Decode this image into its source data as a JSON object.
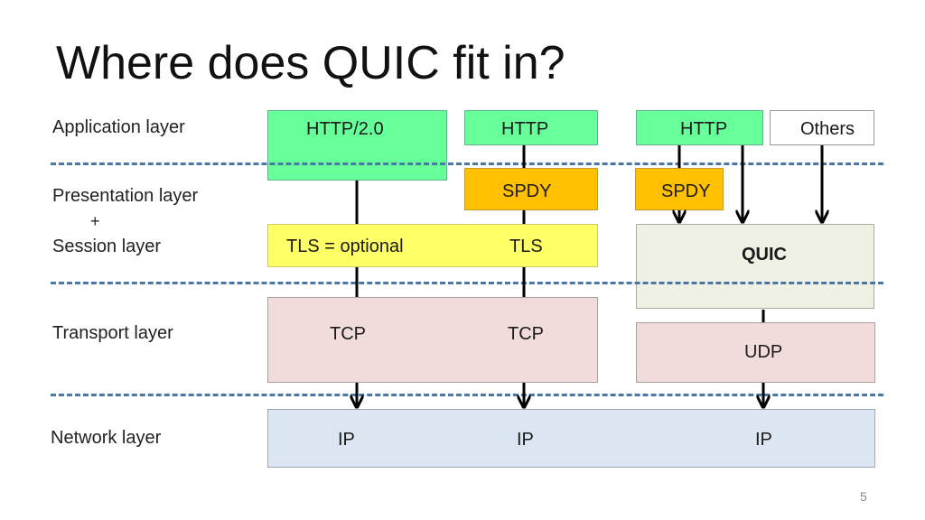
{
  "slide": {
    "title": "Where does QUIC fit in?",
    "page_number": "5"
  },
  "layers": {
    "application": "Application layer",
    "presentation": "Presentation layer",
    "plus": "+",
    "session": "Session layer",
    "transport": "Transport layer",
    "network": "Network layer"
  },
  "boxes": {
    "http2": "HTTP/2.0",
    "http_spdy": "HTTP",
    "http_quic": "HTTP",
    "others": "Others",
    "spdy_middle": "SPDY",
    "spdy_right": "SPDY",
    "tls_optional": "TLS = optional",
    "tls": "TLS",
    "quic": "QUIC",
    "tcp_left": "TCP",
    "tcp_right": "TCP",
    "udp": "UDP",
    "ip_left": "IP",
    "ip_middle": "IP",
    "ip_right": "IP"
  },
  "colors": {
    "http": "#66ff99",
    "spdy": "#ffc000",
    "tls": "#ffff66",
    "quic": "#eef1e4",
    "transport": "#f2dcdb",
    "network": "#dce6f2",
    "divider": "#4a76a8"
  }
}
